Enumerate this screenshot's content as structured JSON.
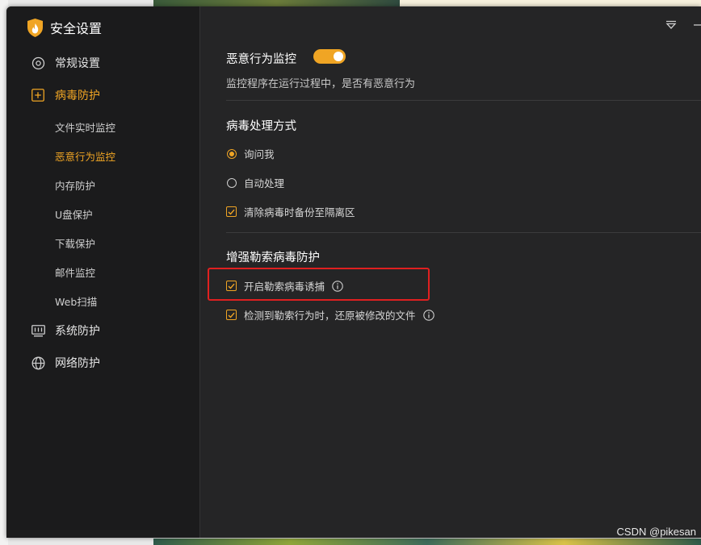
{
  "app": {
    "title": "安全设置"
  },
  "colors": {
    "accent": "#f0a524",
    "highlight": "#e02020"
  },
  "sidebar": {
    "items": [
      {
        "label": "常规设置",
        "icon": "gear-icon"
      },
      {
        "label": "病毒防护",
        "icon": "plus-square-icon",
        "active": true
      },
      {
        "label": "系统防护",
        "icon": "system-monitor-icon"
      },
      {
        "label": "网络防护",
        "icon": "globe-icon"
      }
    ],
    "sub_items": [
      {
        "label": "文件实时监控"
      },
      {
        "label": "恶意行为监控",
        "active": true
      },
      {
        "label": "内存防护"
      },
      {
        "label": "U盘保护"
      },
      {
        "label": "下载保护"
      },
      {
        "label": "邮件监控"
      },
      {
        "label": "Web扫描"
      }
    ]
  },
  "main": {
    "monitor": {
      "title": "恶意行为监控",
      "toggle_on": true,
      "description": "监控程序在运行过程中，是否有恶意行为"
    },
    "virus_handling": {
      "title": "病毒处理方式",
      "options": [
        {
          "label": "询问我",
          "type": "radio",
          "checked": true
        },
        {
          "label": "自动处理",
          "type": "radio",
          "checked": false
        },
        {
          "label": "清除病毒时备份至隔离区",
          "type": "checkbox",
          "checked": true
        }
      ]
    },
    "ransomware": {
      "title": "增强勒索病毒防护",
      "options": [
        {
          "label": "开启勒索病毒诱捕",
          "checked": true,
          "info": true
        },
        {
          "label": "检测到勒索行为时，还原被修改的文件",
          "checked": true,
          "info": true
        }
      ]
    }
  },
  "watermark": "CSDN @pikesan"
}
